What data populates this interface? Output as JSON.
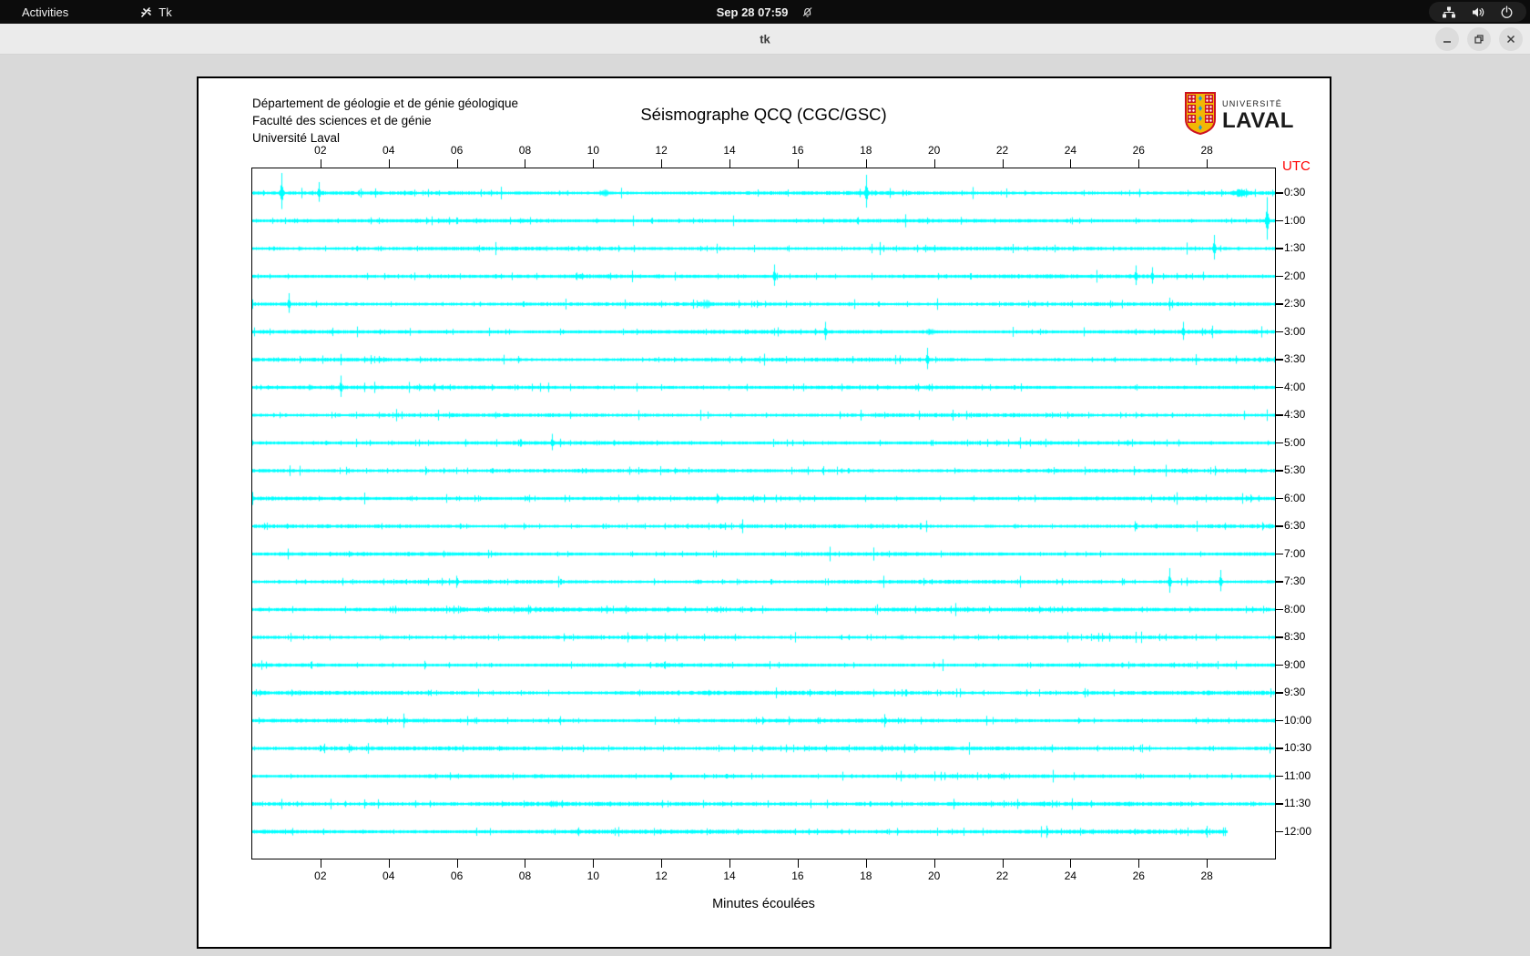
{
  "topbar": {
    "activities_label": "Activities",
    "app_label": "Tk",
    "clock": "Sep 28 07:59"
  },
  "titlebar": {
    "title": "tk"
  },
  "document": {
    "org_lines": [
      "Département de géologie et de génie géologique",
      "Faculté des sciences et de génie",
      "Université Laval"
    ],
    "title": "Séismographe QCQ (CGC/GSC)",
    "logo_small": "UNIVERSITÉ",
    "logo_large": "LAVAL",
    "utc_label": "UTC",
    "xlabel": "Minutes écoulées"
  },
  "chart_data": {
    "type": "line",
    "title": "Séismographe QCQ (CGC/GSC)",
    "xlabel": "Minutes écoulées",
    "x_range": [
      0,
      30
    ],
    "x_ticks": [
      "02",
      "04",
      "06",
      "08",
      "10",
      "12",
      "14",
      "16",
      "18",
      "20",
      "22",
      "24",
      "26",
      "28"
    ],
    "x_tick_minutes": [
      2,
      4,
      6,
      8,
      10,
      12,
      14,
      16,
      18,
      20,
      22,
      24,
      26,
      28
    ],
    "y_axis_label": "UTC",
    "trace_color": "#00ffff",
    "axis_color": "#000000",
    "utc_color": "#ff0000",
    "legend": "24 half-hour seismogram traces, amplitude spikes listed as [minute, amplitude_px, burst_width_min]",
    "rows": [
      {
        "label": "0:30",
        "end_min": 30,
        "spikes": [
          [
            0.85,
            22,
            0
          ],
          [
            1.95,
            12,
            0
          ],
          [
            10.35,
            4,
            0.5
          ],
          [
            18.0,
            20,
            0
          ],
          [
            29.0,
            5,
            0.8
          ]
        ]
      },
      {
        "label": "1:00",
        "end_min": 30,
        "spikes": [
          [
            29.75,
            26,
            0
          ]
        ]
      },
      {
        "label": "1:30",
        "end_min": 30,
        "spikes": [
          [
            28.2,
            15,
            0
          ]
        ]
      },
      {
        "label": "2:00",
        "end_min": 30,
        "spikes": [
          [
            15.3,
            13,
            0
          ],
          [
            25.9,
            12,
            0
          ],
          [
            26.4,
            10,
            0
          ],
          [
            27.9,
            5,
            0
          ]
        ]
      },
      {
        "label": "2:30",
        "end_min": 30,
        "spikes": [
          [
            1.06,
            12,
            0
          ],
          [
            13.3,
            5,
            0.5
          ]
        ]
      },
      {
        "label": "3:00",
        "end_min": 30,
        "spikes": [
          [
            16.8,
            11,
            0
          ],
          [
            19.9,
            4,
            0.4
          ],
          [
            27.3,
            11,
            0
          ]
        ]
      },
      {
        "label": "3:30",
        "end_min": 30,
        "spikes": [
          [
            19.8,
            13,
            0
          ]
        ]
      },
      {
        "label": "4:00",
        "end_min": 30,
        "spikes": [
          [
            1.7,
            4,
            0.2
          ],
          [
            2.6,
            13,
            0
          ]
        ]
      },
      {
        "label": "4:30",
        "end_min": 30,
        "spikes": []
      },
      {
        "label": "5:00",
        "end_min": 30,
        "spikes": [
          [
            8.8,
            10,
            0
          ]
        ]
      },
      {
        "label": "5:30",
        "end_min": 30,
        "spikes": []
      },
      {
        "label": "6:00",
        "end_min": 30,
        "spikes": []
      },
      {
        "label": "6:30",
        "end_min": 30,
        "spikes": [
          [
            22.4,
            3,
            0.3
          ]
        ]
      },
      {
        "label": "7:00",
        "end_min": 30,
        "spikes": []
      },
      {
        "label": "7:30",
        "end_min": 30,
        "spikes": [
          [
            26.9,
            15,
            0
          ],
          [
            28.4,
            13,
            0
          ]
        ]
      },
      {
        "label": "8:00",
        "end_min": 30,
        "noise": 1.15,
        "spikes": [
          [
            13.6,
            3,
            0.2
          ]
        ]
      },
      {
        "label": "8:30",
        "end_min": 30,
        "spikes": []
      },
      {
        "label": "9:00",
        "end_min": 30,
        "spikes": []
      },
      {
        "label": "9:30",
        "end_min": 30,
        "noise": 1.1,
        "spikes": []
      },
      {
        "label": "10:00",
        "end_min": 30,
        "spikes": []
      },
      {
        "label": "10:30",
        "end_min": 30,
        "noise": 1.1,
        "spikes": []
      },
      {
        "label": "11:00",
        "end_min": 30,
        "spikes": []
      },
      {
        "label": "11:30",
        "end_min": 30,
        "noise": 1.15,
        "spikes": []
      },
      {
        "label": "12:00",
        "end_min": 28.6,
        "noise": 1.1,
        "spikes": []
      }
    ]
  }
}
